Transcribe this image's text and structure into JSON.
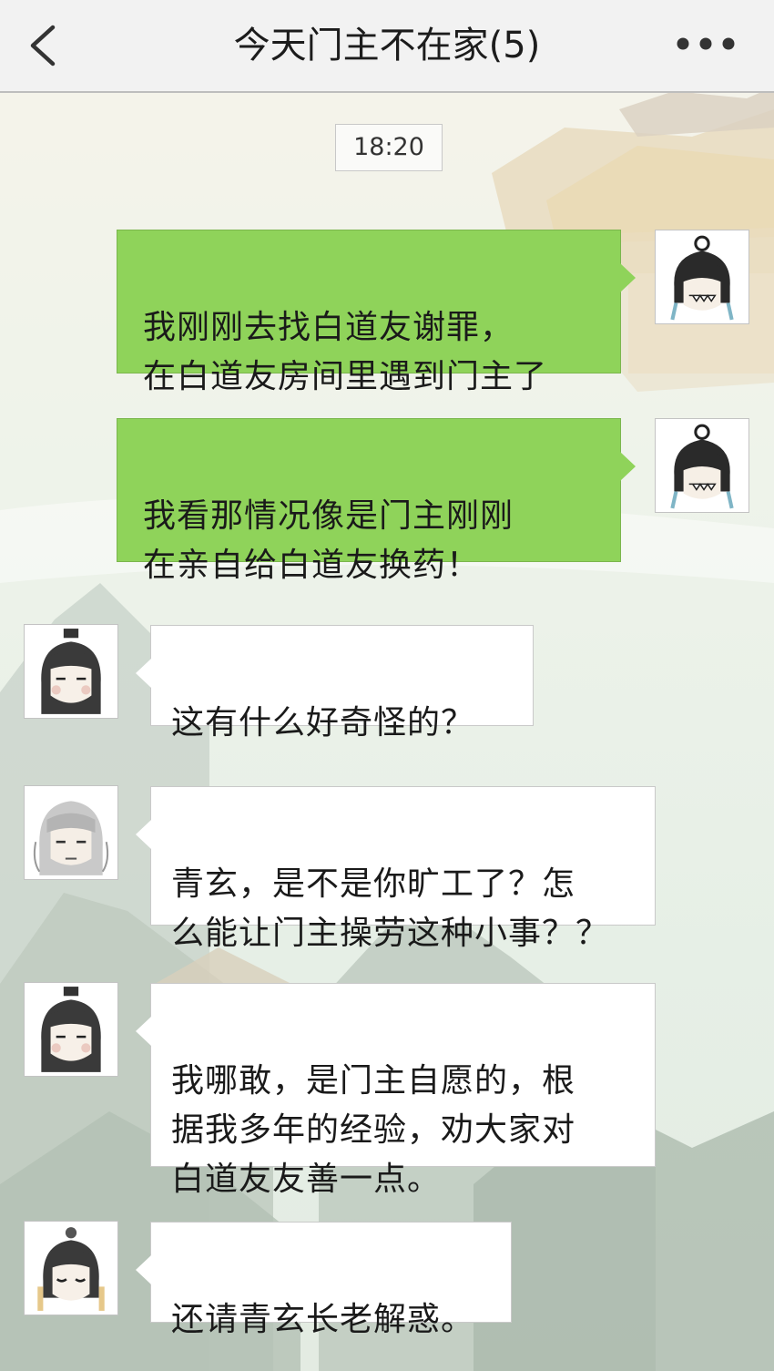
{
  "header": {
    "title": "今天门主不在家(5)",
    "back_icon": "chevron-left-icon",
    "more_icon": "more-dots-icon"
  },
  "timestamp": "18:20",
  "colors": {
    "my_bubble": "#8fd35a",
    "other_bubble": "#ffffff",
    "header_bg": "#f2f2f2"
  },
  "messages": [
    {
      "side": "right",
      "avatar": "avatar-grinning-black-hair",
      "text": "我刚刚去找白道友谢罪，\n在白道友房间里遇到门主了"
    },
    {
      "side": "right",
      "avatar": "avatar-grinning-black-hair",
      "text": "我看那情况像是门主刚刚\n在亲自给白道友换药！"
    },
    {
      "side": "left",
      "avatar": "avatar-qingxuan",
      "text": "这有什么好奇怪的？"
    },
    {
      "side": "left",
      "avatar": "avatar-elder-grey-hair",
      "text": "青玄，是不是你旷工了？怎\n么能让门主操劳这种小事？？"
    },
    {
      "side": "left",
      "avatar": "avatar-qingxuan",
      "text": "我哪敢，是门主自愿的，根\n据我多年的经验，劝大家对\n白道友友善一点。"
    },
    {
      "side": "left",
      "avatar": "avatar-sleepy-disciple",
      "text": "还请青玄长老解惑。"
    }
  ]
}
